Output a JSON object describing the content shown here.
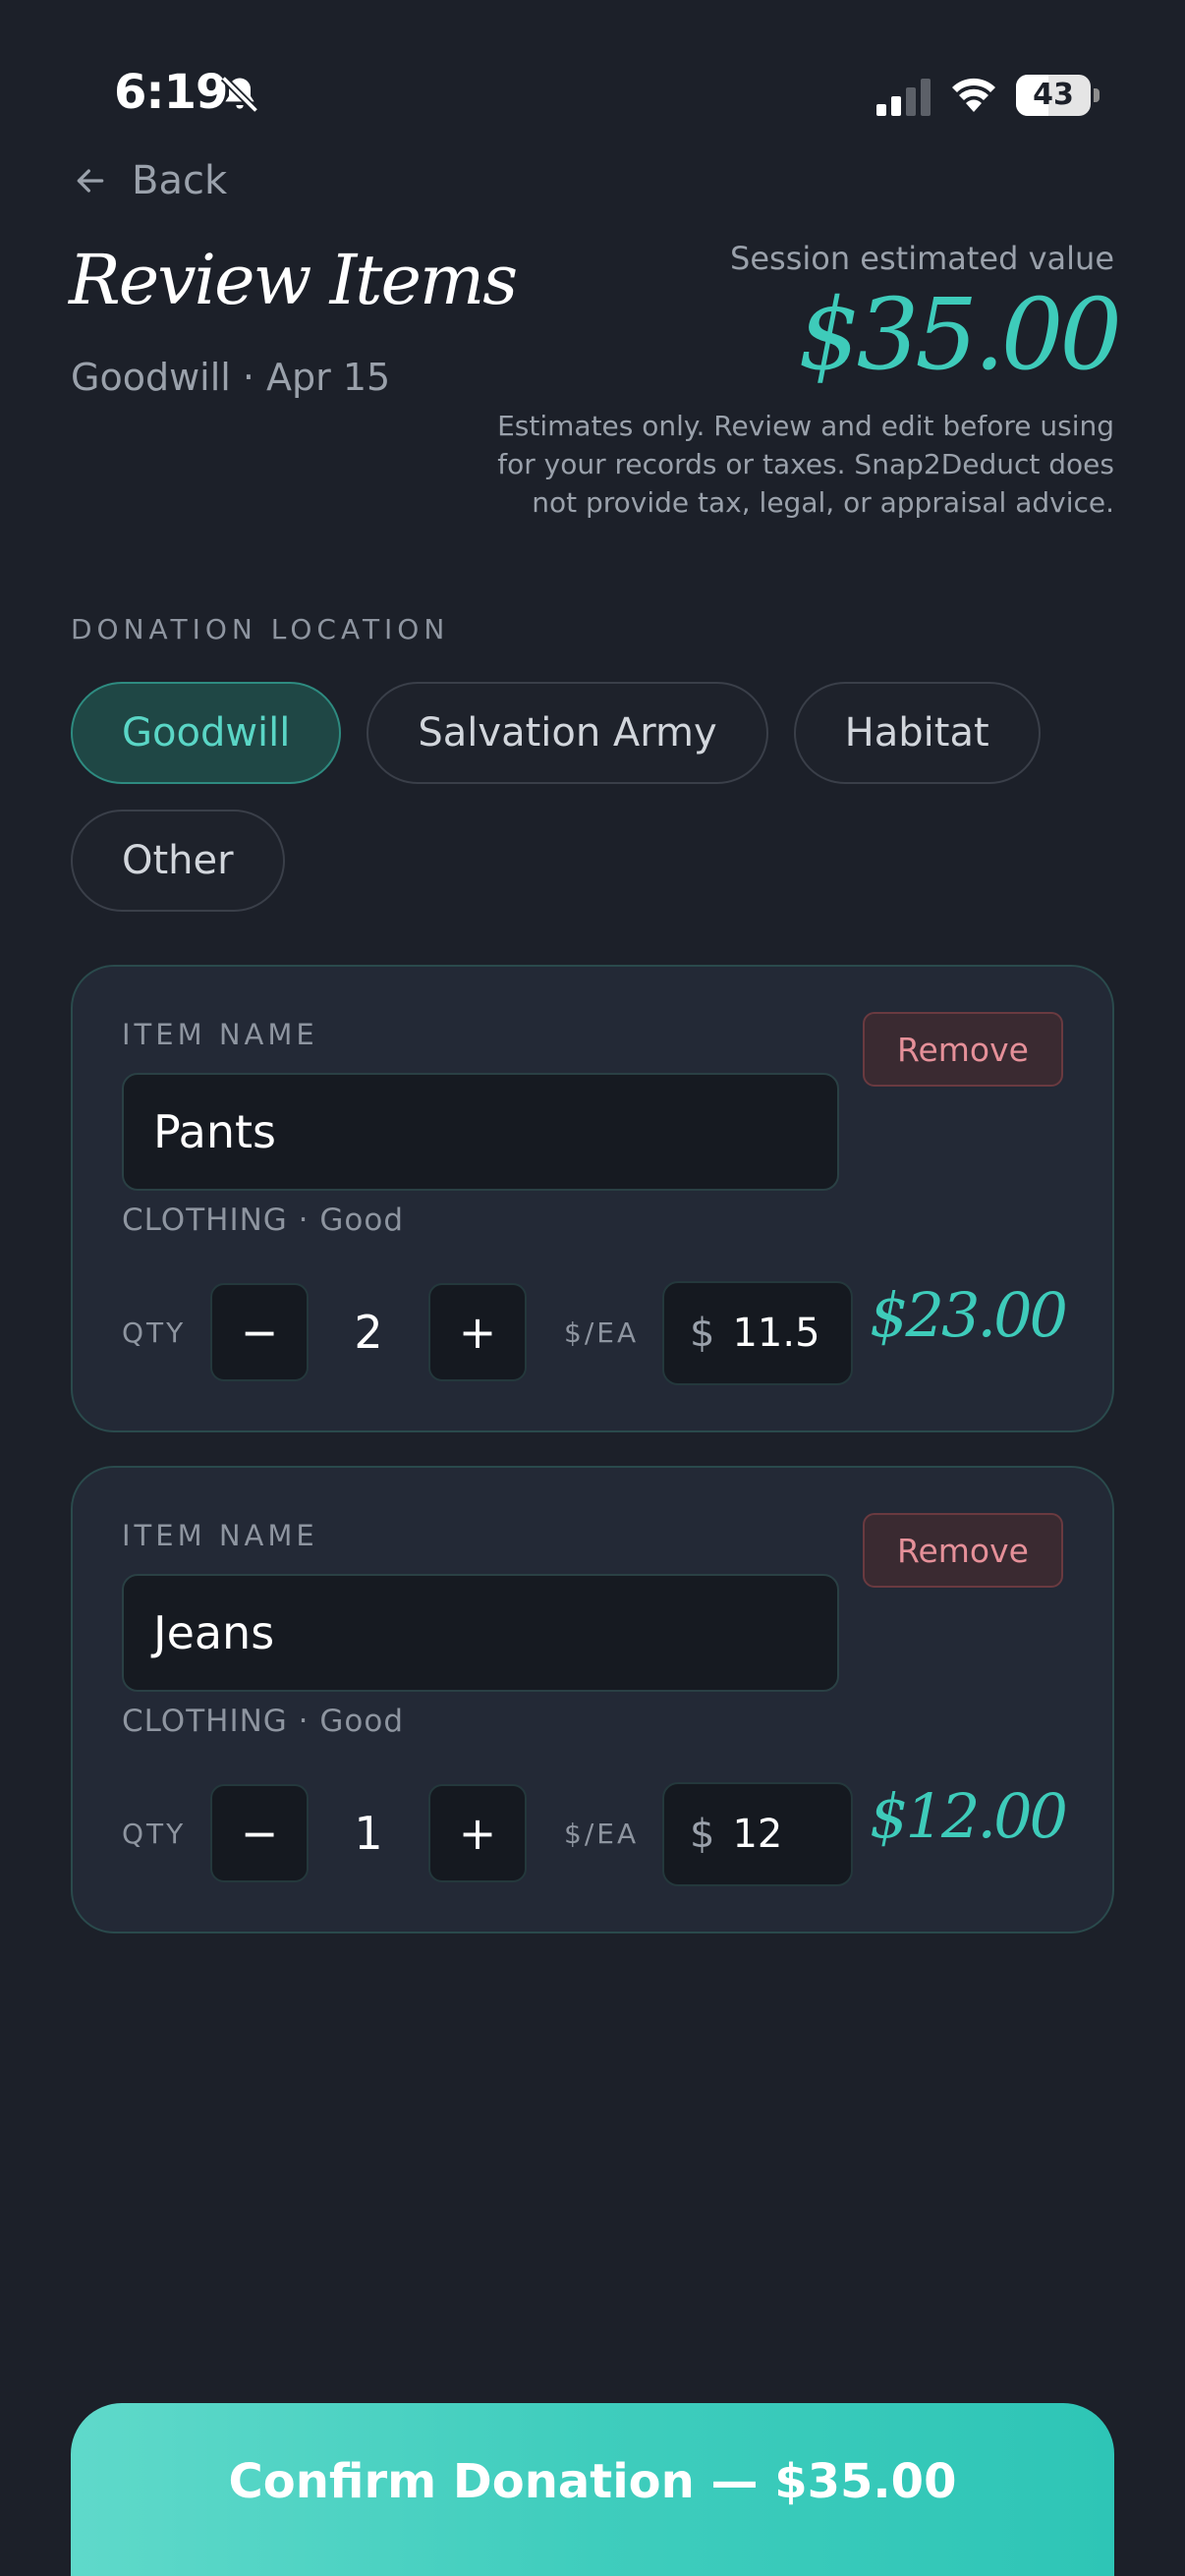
{
  "status_bar": {
    "time": "6:19",
    "battery_level": "43",
    "battery_fraction": 0.43
  },
  "nav": {
    "back_label": "Back"
  },
  "header": {
    "title": "Review Items",
    "subtitle": "Goodwill · Apr 15",
    "estimate_label": "Session estimated value",
    "estimate_value": "$35.00",
    "disclaimer": "Estimates only. Review and edit before using for your records or taxes. Snap2Deduct does not provide tax, legal, or appraisal advice."
  },
  "donation_location": {
    "label": "DONATION LOCATION",
    "options": [
      {
        "label": "Goodwill",
        "selected": true
      },
      {
        "label": "Salvation Army",
        "selected": false
      },
      {
        "label": "Habitat",
        "selected": false
      },
      {
        "label": "Other",
        "selected": false
      }
    ]
  },
  "items": [
    {
      "name_label": "ITEM NAME",
      "name": "Pants",
      "category": "CLOTHING · Good",
      "remove_label": "Remove",
      "qty_label": "QTY",
      "minus": "−",
      "qty": "2",
      "plus": "+",
      "each_label": "$/EA",
      "currency": "$",
      "price": "11.5",
      "total": "$23.00"
    },
    {
      "name_label": "ITEM NAME",
      "name": "Jeans",
      "category": "CLOTHING · Good",
      "remove_label": "Remove",
      "qty_label": "QTY",
      "minus": "−",
      "qty": "1",
      "plus": "+",
      "each_label": "$/EA",
      "currency": "$",
      "price": "12",
      "total": "$12.00"
    }
  ],
  "confirm": {
    "label": "Confirm Donation — $35.00"
  },
  "colors": {
    "background": "#1c2029",
    "accent": "#3ecbba",
    "danger": "#e59099"
  },
  "icons": [
    "bell-slash-icon",
    "signal-icon",
    "wifi-icon",
    "battery-icon",
    "arrow-left-icon"
  ]
}
